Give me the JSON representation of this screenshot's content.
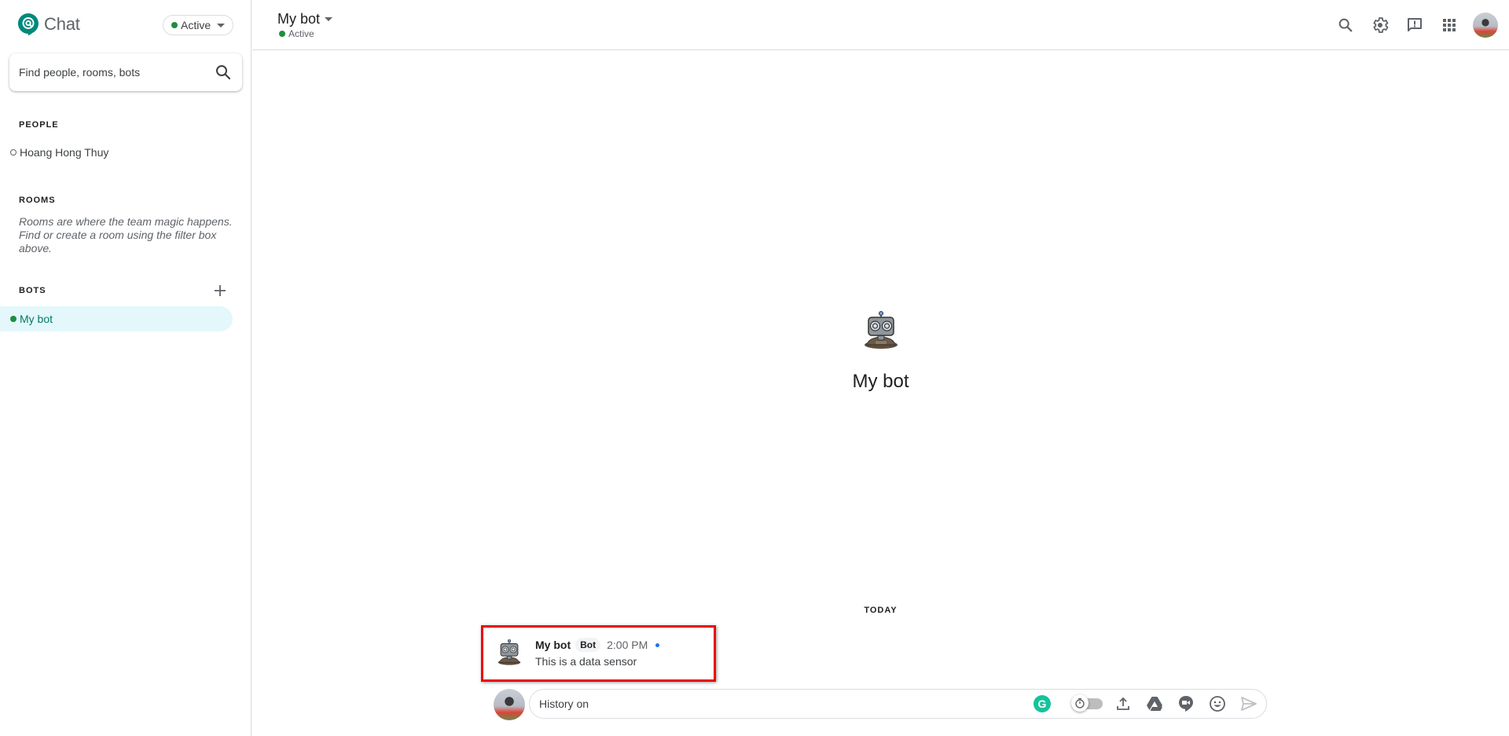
{
  "app": {
    "name": "Chat",
    "status_label": "Active",
    "accent_color": "#00897b",
    "status_color": "#1e8e3e"
  },
  "sidebar": {
    "search_placeholder": "Find people, rooms, bots",
    "sections": {
      "people": {
        "label": "PEOPLE",
        "items": [
          {
            "name": "Hoang Hong Thuy",
            "presence": "offline"
          }
        ]
      },
      "rooms": {
        "label": "ROOMS",
        "hint": "Rooms are where the team magic happens. Find or create a room using the filter box above."
      },
      "bots": {
        "label": "BOTS",
        "add_icon": "plus-icon",
        "items": [
          {
            "name": "My bot",
            "presence": "active",
            "selected": true
          }
        ]
      }
    }
  },
  "header": {
    "title": "My bot",
    "status": "Active",
    "icons": [
      "search-icon",
      "gear-icon",
      "feedback-icon",
      "apps-grid-icon",
      "account-avatar"
    ]
  },
  "conversation": {
    "intro_title": "My bot",
    "date_divider": "TODAY",
    "messages": [
      {
        "sender": "My bot",
        "badge": "Bot",
        "time": "2:00 PM",
        "text": "This is a data sensor",
        "unread": true,
        "highlighted": true
      }
    ]
  },
  "composer": {
    "placeholder": "History on",
    "tools": [
      "grammarly-icon",
      "history-toggle",
      "upload-icon",
      "drive-icon",
      "meet-icon",
      "emoji-icon",
      "send-icon"
    ]
  }
}
